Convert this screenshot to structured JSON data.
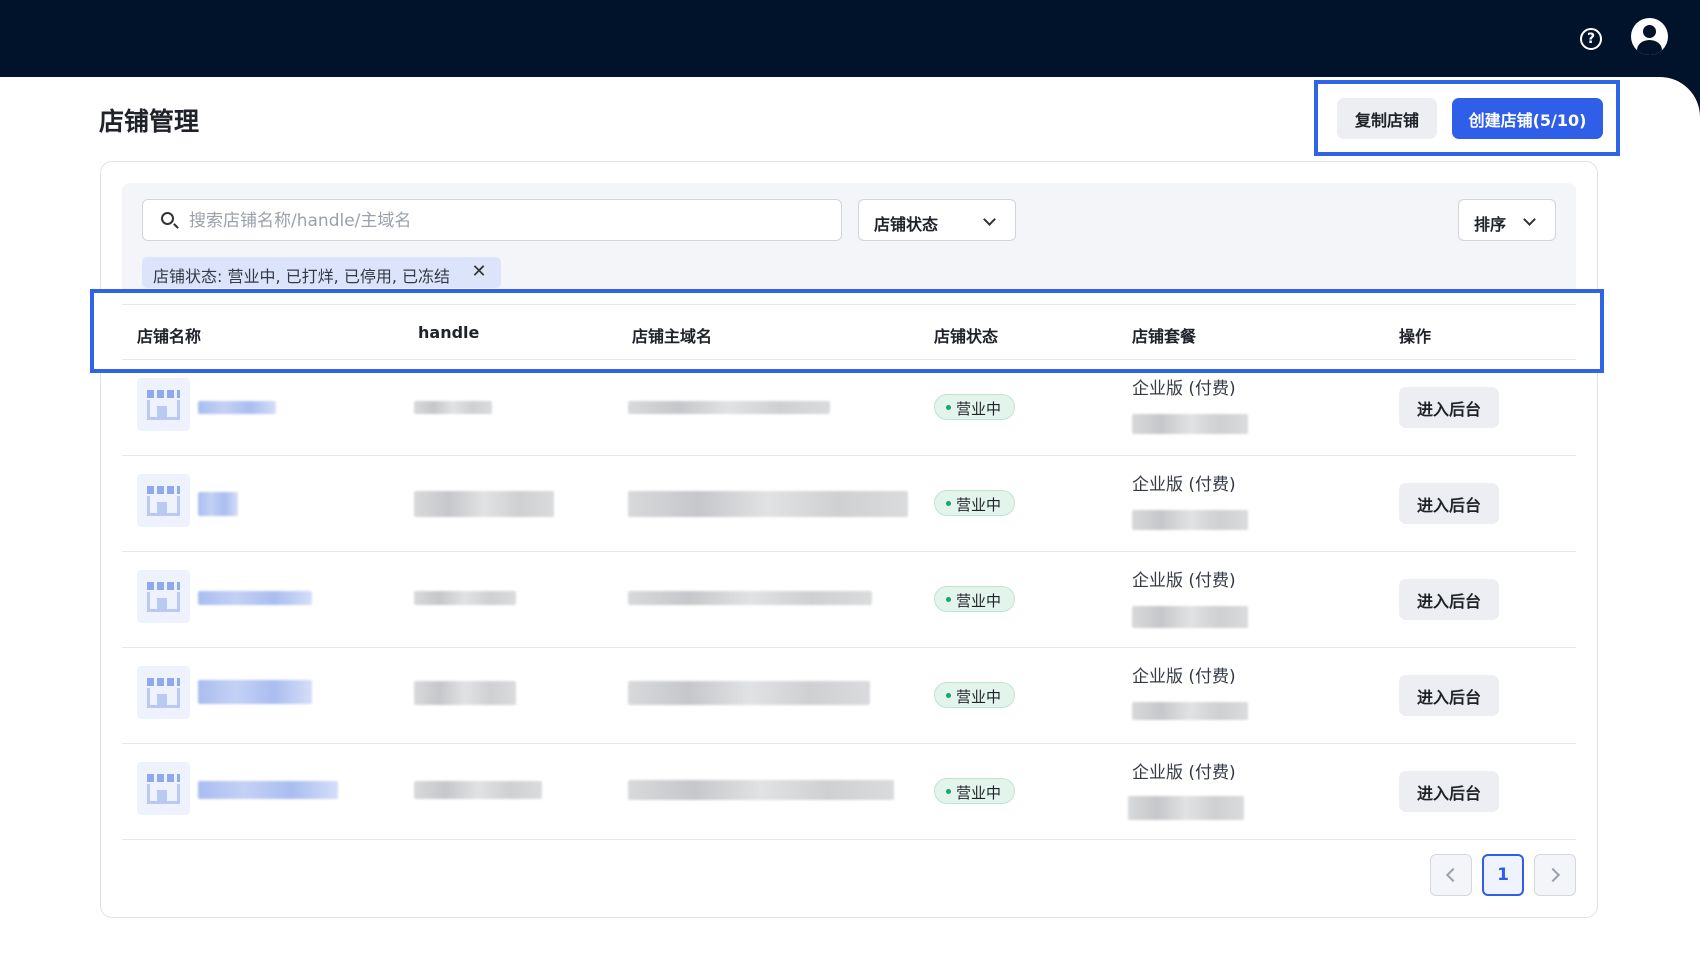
{
  "header": {
    "help_icon": "question-circle-icon",
    "avatar_icon": "user-avatar-icon"
  },
  "page": {
    "title": "店铺管理",
    "copy_label": "复制店铺",
    "create_label": "创建店铺(5/10)"
  },
  "filters": {
    "search_placeholder": "搜索店铺名称/handle/主域名",
    "status_label": "店铺状态",
    "sort_label": "排序",
    "active_filter": "店铺状态: 营业中, 已打烊, 已停用, 已冻结",
    "close_glyph": "✕"
  },
  "table": {
    "columns": [
      "店铺名称",
      "handle",
      "店铺主域名",
      "店铺状态",
      "店铺套餐",
      "操作"
    ],
    "rows": [
      {
        "status": "营业中",
        "plan": "企业版 (付费)",
        "action": "进入后台"
      },
      {
        "status": "营业中",
        "plan": "企业版 (付费)",
        "action": "进入后台"
      },
      {
        "status": "营业中",
        "plan": "企业版 (付费)",
        "action": "进入后台"
      },
      {
        "status": "营业中",
        "plan": "企业版 (付费)",
        "action": "进入后台"
      },
      {
        "status": "营业中",
        "plan": "企业版 (付费)",
        "action": "进入后台"
      }
    ]
  },
  "pagination": {
    "current_page": "1"
  },
  "colors": {
    "topbar": "#00132b",
    "primary": "#2f5ee8",
    "highlight_frame": "#2f63e8",
    "status_dot": "#17a56b"
  }
}
